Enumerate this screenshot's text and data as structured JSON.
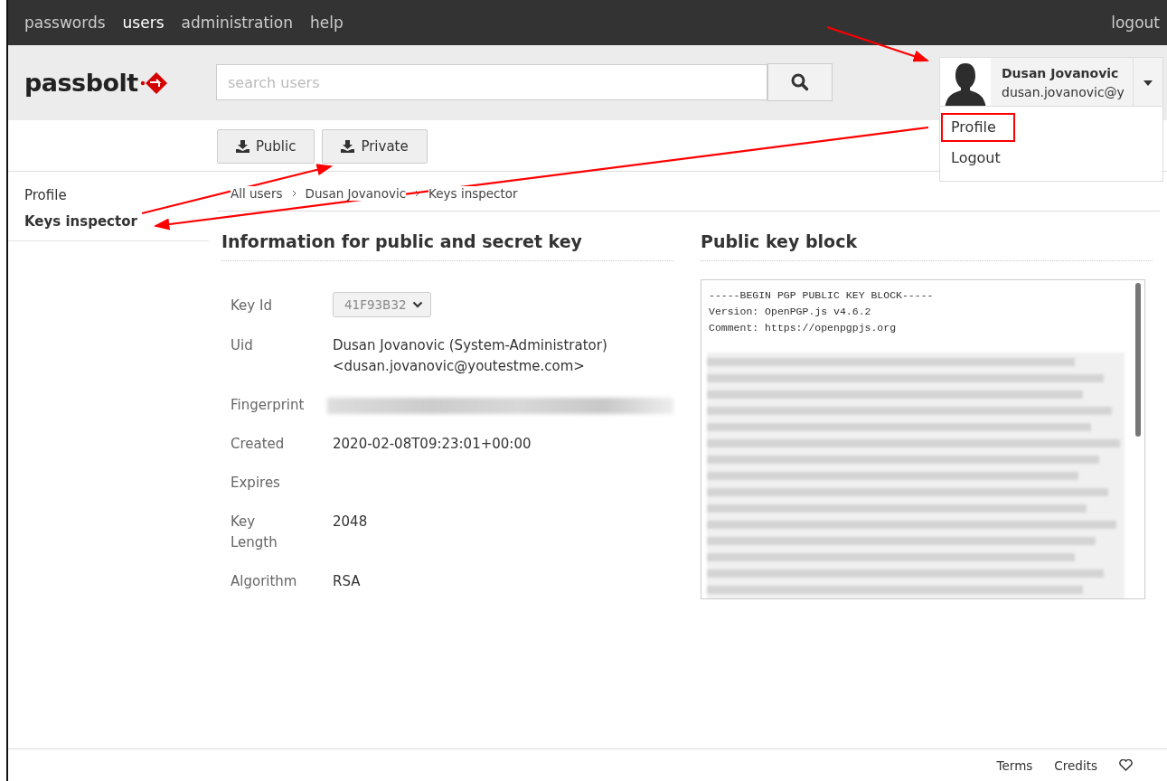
{
  "nav": {
    "items": [
      {
        "label": "passwords",
        "selected": false
      },
      {
        "label": "users",
        "selected": true
      },
      {
        "label": "administration",
        "selected": false
      },
      {
        "label": "help",
        "selected": false
      }
    ],
    "logout": "logout"
  },
  "logo": "passbolt",
  "search": {
    "placeholder": "search users"
  },
  "user": {
    "name": "Dusan Jovanovic",
    "email": "dusan.jovanovic@y",
    "menu": [
      {
        "label": "Profile",
        "highlighted": true
      },
      {
        "label": "Logout",
        "highlighted": false
      }
    ]
  },
  "actions": [
    "Public",
    "Private"
  ],
  "sidebar": {
    "items": [
      {
        "label": "Profile",
        "selected": false
      },
      {
        "label": "Keys inspector",
        "selected": true
      }
    ]
  },
  "breadcrumb": [
    "All users",
    "Dusan Jovanovic",
    "Keys inspector"
  ],
  "info": {
    "title": "Information for public and secret key",
    "rows": [
      {
        "label": "Key Id",
        "kind": "select",
        "value": "41F93B32"
      },
      {
        "label": "Uid",
        "kind": "text",
        "lines": [
          "Dusan Jovanovic (System-Administrator)",
          "<dusan.jovanovic@youtestme.com>"
        ]
      },
      {
        "label": "Fingerprint",
        "kind": "redacted"
      },
      {
        "label": "Created",
        "kind": "text",
        "lines": [
          "2020-02-08T09:23:01+00:00"
        ]
      },
      {
        "label": "Expires",
        "kind": "text",
        "lines": []
      },
      {
        "label": "Key Length",
        "kind": "text",
        "lines": [
          "2048"
        ]
      },
      {
        "label": "Algorithm",
        "kind": "text",
        "lines": [
          "RSA"
        ]
      }
    ]
  },
  "key_block": {
    "title": "Public key block",
    "lines": [
      "-----BEGIN PGP PUBLIC KEY BLOCK-----",
      "Version: OpenPGP.js v4.6.2",
      "Comment: https://openpgpjs.org"
    ]
  },
  "footer": {
    "links": [
      "Terms",
      "Credits"
    ]
  }
}
